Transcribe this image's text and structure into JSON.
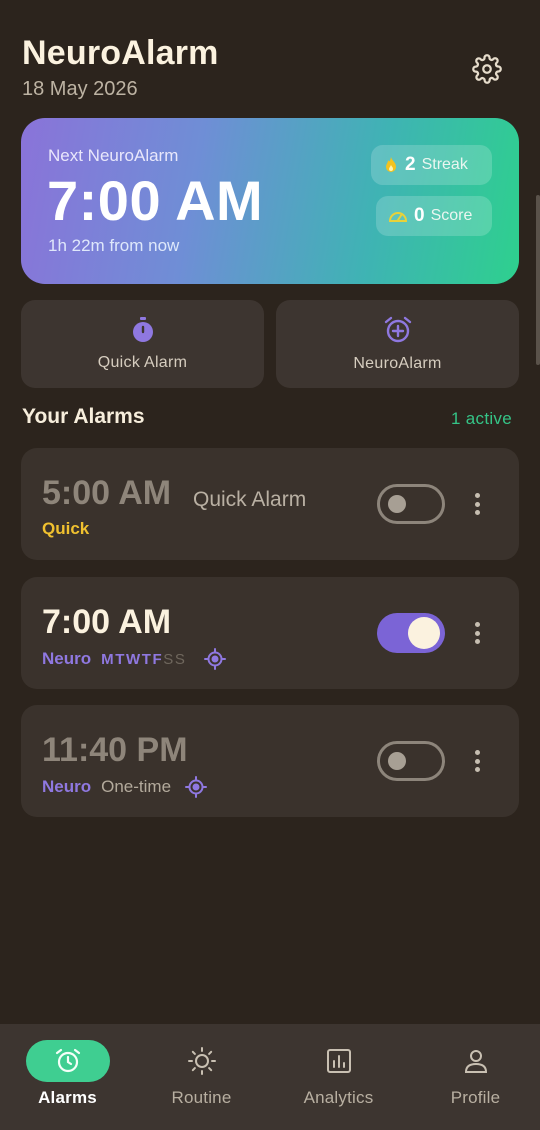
{
  "header": {
    "title": "NeuroAlarm",
    "date": "18 May 2026",
    "settings_icon": "gear-icon"
  },
  "hero": {
    "label": "Next NeuroAlarm",
    "time": "7:00 AM",
    "subtitle": "1h 22m from now",
    "streak": {
      "value": "2",
      "label": "Streak",
      "icon": "flame-icon"
    },
    "score": {
      "value": "0",
      "label": "Score",
      "icon": "gauge-icon"
    },
    "colors": {
      "start": "#8a73d9",
      "end": "#2ed08e"
    }
  },
  "quick_actions": [
    {
      "label": "Quick Alarm",
      "icon": "stopwatch-icon"
    },
    {
      "label": "NeuroAlarm",
      "icon": "alarm-plus-icon"
    }
  ],
  "alarms_section": {
    "title": "Your Alarms",
    "count_text": "1 active"
  },
  "alarms": [
    {
      "time": "5:00 AM",
      "name": "Quick Alarm",
      "type": "Quick",
      "enabled": false
    },
    {
      "time": "7:00 AM",
      "name": "",
      "type": "Neuro",
      "enabled": true,
      "days": [
        {
          "d": "M",
          "on": true
        },
        {
          "d": "T",
          "on": true
        },
        {
          "d": "W",
          "on": true
        },
        {
          "d": "T",
          "on": true
        },
        {
          "d": "F",
          "on": true
        },
        {
          "d": "S",
          "on": false
        },
        {
          "d": "S",
          "on": false
        }
      ]
    },
    {
      "time": "11:40 PM",
      "name": "",
      "type": "Neuro",
      "repeat": "One-time",
      "enabled": false
    }
  ],
  "nav": {
    "active": "Alarms",
    "items": [
      {
        "label": "Alarms",
        "icon": "alarm-clock-icon"
      },
      {
        "label": "Routine",
        "icon": "sun-icon"
      },
      {
        "label": "Analytics",
        "icon": "bar-chart-icon"
      },
      {
        "label": "Profile",
        "icon": "person-icon"
      }
    ]
  },
  "colors": {
    "background": "#2c241d",
    "card": "#3a322c",
    "accent_purple": "#7b64d6",
    "accent_green": "#3fce91",
    "quick_yellow": "#f0c12f"
  }
}
